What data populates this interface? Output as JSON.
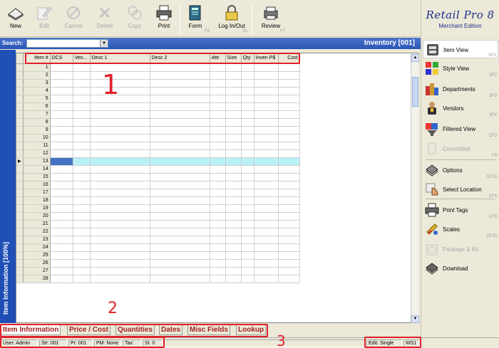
{
  "toolbar": {
    "buttons": [
      {
        "label": "New",
        "key": "",
        "disabled": false
      },
      {
        "label": "Edit",
        "key": "",
        "disabled": true
      },
      {
        "label": "Cancel",
        "key": "",
        "disabled": true
      },
      {
        "label": "Delete",
        "key": "",
        "disabled": true
      },
      {
        "label": "Copy",
        "key": "",
        "disabled": true
      },
      {
        "label": "Print",
        "key": "",
        "disabled": false
      },
      {
        "label": "Form",
        "key": "F8",
        "disabled": false
      },
      {
        "label": "Log In/Out",
        "key": "CL",
        "disabled": false
      },
      {
        "label": "Review",
        "key": "F7",
        "disabled": false
      }
    ]
  },
  "brand": {
    "logo": "Retail Pro 8",
    "edition": "Merchant Edition"
  },
  "search": {
    "label": "Search:",
    "value": "",
    "title": "Inventory [001]"
  },
  "left_panel": {
    "label": "Item Information [100%]"
  },
  "grid": {
    "columns": [
      "Item #",
      "DCS",
      "Ven...",
      "Desc 1",
      "Desc 2",
      "Attr",
      "Size",
      "Qty",
      "Inven P$",
      "Cost"
    ],
    "rows": [
      "1",
      "2",
      "3",
      "4",
      "5",
      "6",
      "7",
      "8",
      "9",
      "10",
      "11",
      "12",
      "13",
      "14",
      "15",
      "16",
      "17",
      "18",
      "19",
      "20",
      "21",
      "22",
      "23",
      "24",
      "25",
      "26",
      "27",
      "28"
    ],
    "selected_row": "13",
    "row_marker": "▶"
  },
  "tabs": [
    {
      "label": "Item Information",
      "active": true
    },
    {
      "label": "Price / Cost",
      "active": false
    },
    {
      "label": "Quantities",
      "active": false
    },
    {
      "label": "Dates",
      "active": false
    },
    {
      "label": "Misc Fields",
      "active": false
    },
    {
      "label": "Lookup",
      "active": false
    }
  ],
  "status": {
    "user": "User: Admin",
    "store": "Str: 001",
    "price": "Pr: 001",
    "pm": "PM: None",
    "tax": "Tax:",
    "si": "SI: 0",
    "edit": "Edit: Single",
    "ws": "WS1"
  },
  "right_panel": {
    "items": [
      {
        "label": "Item View",
        "key": "SF1",
        "disabled": false,
        "icon": "item-view-icon"
      },
      {
        "label": "Style View",
        "key": "SF2",
        "disabled": false,
        "icon": "style-view-icon"
      },
      {
        "label": "Departments",
        "key": "SF3",
        "disabled": false,
        "icon": "departments-icon"
      },
      {
        "label": "Vendors",
        "key": "SF4",
        "disabled": false,
        "icon": "vendors-icon"
      },
      {
        "label": "Filtered View",
        "key": "CF3",
        "disabled": false,
        "icon": "filtered-view-icon"
      },
      {
        "label": "Committed",
        "key": "F9",
        "disabled": true,
        "icon": "committed-icon"
      },
      {
        "label": "Options",
        "key": "SF10",
        "disabled": false,
        "icon": "options-icon"
      },
      {
        "label": "Select Location",
        "key": "CF4",
        "disabled": false,
        "icon": "select-location-icon"
      },
      {
        "label": "Print Tags",
        "key": "CF9",
        "disabled": false,
        "icon": "print-tags-icon"
      },
      {
        "label": "Scales",
        "key": "CF10",
        "disabled": false,
        "icon": "scales-icon"
      },
      {
        "label": "Package & Kit",
        "key": "",
        "disabled": true,
        "icon": "package-kit-icon"
      },
      {
        "label": "Download",
        "key": "",
        "disabled": false,
        "icon": "download-icon"
      }
    ]
  },
  "annotations": {
    "one": "1",
    "two": "2",
    "three": "3"
  },
  "colors": {
    "accent": "#2a56b7",
    "annotation": "#e0202a",
    "selected_row": "#b8f0f5",
    "tab_text": "#a02020"
  }
}
